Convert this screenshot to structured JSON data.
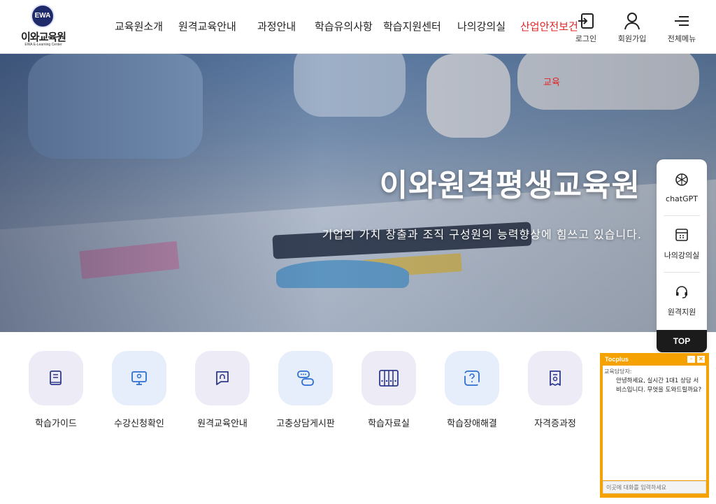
{
  "header": {
    "logo_mark": "EWA",
    "logo_name": "이와교육원",
    "logo_sub": "EWA E-Learning Center",
    "nav": [
      "교육원소개",
      "원격교육안내",
      "과정안내",
      "학습유의사항",
      "학습지원센터",
      "나의강의실",
      "산업안전보건"
    ],
    "nav_sub_active": "교육",
    "util": {
      "login": "로그인",
      "signup": "회원가입",
      "menu": "전체메뉴"
    }
  },
  "hero": {
    "title": "이와원격평생교육원",
    "subtitle": "기업의 가치 창출과 조직 구성원의 능력향상에 힘쓰고 있습니다."
  },
  "quick_menu": [
    {
      "label": "학습가이드",
      "icon": "book-icon"
    },
    {
      "label": "수강신청확인",
      "icon": "monitor-user-icon"
    },
    {
      "label": "원격교육안내",
      "icon": "chat-headset-icon"
    },
    {
      "label": "고충상담게시판",
      "icon": "chat-bubbles-icon"
    },
    {
      "label": "학습자료실",
      "icon": "binders-icon"
    },
    {
      "label": "학습장애해결",
      "icon": "question-icon"
    },
    {
      "label": "자격증과정",
      "icon": "certificate-icon"
    }
  ],
  "side_panel": {
    "items": [
      "chatGPT",
      "나의강의실",
      "원격지원"
    ],
    "top": "TOP"
  },
  "chat": {
    "brand": "Tocplus",
    "agent": "교육담당자:",
    "message": "안녕하세요, 실시간 1대1 상담 서비스입니다. 무엇을 도와드릴까요?",
    "placeholder": "이곳에 대화를 입력하세요"
  },
  "colors": {
    "accent_red": "#e02424",
    "chat_orange": "#f5a200",
    "brand_navy": "#1f2a6b"
  }
}
